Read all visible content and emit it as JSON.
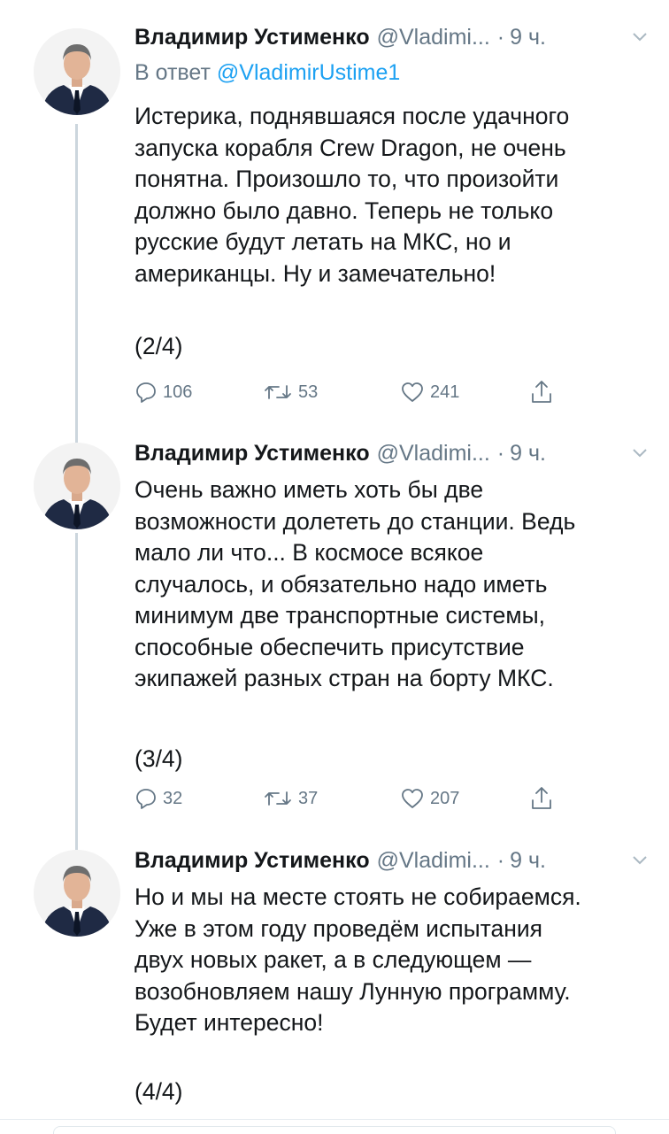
{
  "tweets": [
    {
      "author_name": "Владимир Устименко",
      "author_handle": "@Vladimi...",
      "separator": "·",
      "time": "9 ч.",
      "reply_prefix": "В ответ",
      "reply_mention": "@VladimirUstime1",
      "text_lines": [
        "Истерика, поднявшаяся после удачного",
        "запуска корабля Crew Dragon, не очень",
        "понятна. Произошло то, что произойти",
        "должно было давно. Теперь не только",
        "русские будут летать на МКС, но и",
        "американцы. Ну и замечательно!"
      ],
      "part": "(2/4)",
      "replies": "106",
      "retweets": "53",
      "likes": "241"
    },
    {
      "author_name": "Владимир Устименко",
      "author_handle": "@Vladimi...",
      "separator": "·",
      "time": "9 ч.",
      "text_lines": [
        "Очень важно иметь хоть бы две",
        "возможности долететь до станции. Ведь",
        "мало ли что... В космосе всякое",
        "случалось, и обязательно надо иметь",
        "минимум две транспортные системы,",
        "способные обеспечить присутствие",
        "экипажей разных стран на борту МКС."
      ],
      "part": "(3/4)",
      "replies": "32",
      "retweets": "37",
      "likes": "207"
    },
    {
      "author_name": "Владимир Устименко",
      "author_handle": "@Vladimi...",
      "separator": "·",
      "time": "9 ч.",
      "text_lines": [
        "Но и мы на месте стоять не собираемся.",
        "Уже в этом году проведём испытания",
        "двух новых ракет, а в следующем —",
        "возобновляем нашу Лунную программу.",
        "Будет интересно!"
      ],
      "part": "(4/4)"
    }
  ],
  "icons": {
    "reply": "reply-icon",
    "retweet": "retweet-icon",
    "like": "heart-icon",
    "share": "share-icon",
    "menu": "chevron-down-icon"
  },
  "colors": {
    "link": "#1da1f2",
    "secondary": "#657786",
    "thread_line": "#ccd6dd"
  }
}
